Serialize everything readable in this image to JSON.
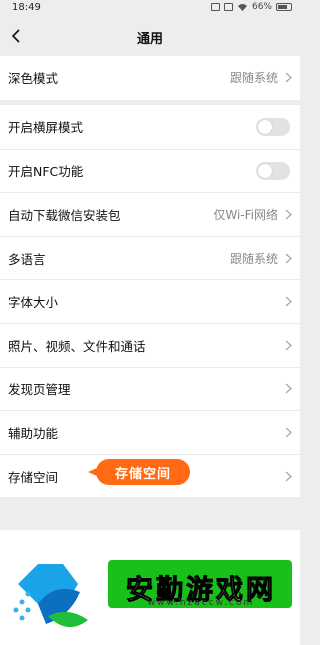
{
  "status_bar": {
    "time": "18:49",
    "battery": "66%"
  },
  "header": {
    "title": "通用"
  },
  "group1": [
    {
      "label": "深色模式",
      "value": "跟随系统",
      "type": "chevron"
    }
  ],
  "group2": [
    {
      "label": "开启横屏模式",
      "type": "toggle",
      "on": false
    },
    {
      "label": "开启NFC功能",
      "type": "toggle",
      "on": false
    },
    {
      "label": "自动下载微信安装包",
      "value": "仅Wi-Fi网络",
      "type": "chevron"
    },
    {
      "label": "多语言",
      "value": "跟随系统",
      "type": "chevron"
    },
    {
      "label": "字体大小",
      "type": "chevron"
    },
    {
      "label": "照片、视频、文件和通话",
      "type": "chevron"
    },
    {
      "label": "发现页管理",
      "type": "chevron"
    },
    {
      "label": "辅助功能",
      "type": "chevron"
    },
    {
      "label": "存储空间",
      "type": "chevron"
    }
  ],
  "callout": {
    "text": "存储空间"
  },
  "watermark": {
    "brand": "安勤游戏网",
    "url": "www.hzaccw.com"
  },
  "colors": {
    "accent_orange": "#ff6a13",
    "brand_green": "#19c019"
  }
}
